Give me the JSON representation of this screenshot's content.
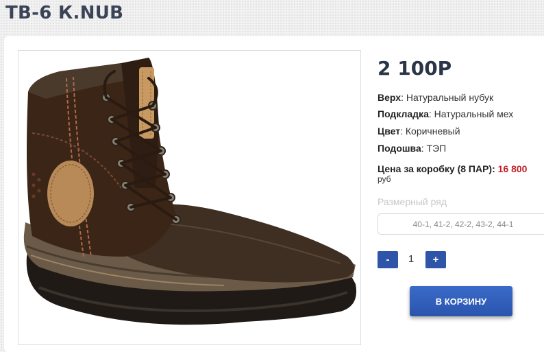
{
  "product": {
    "title": "ТВ-6 К.NUB",
    "price": "2 100Р",
    "image_alt": "brown-leather-nubuck-winter-boot"
  },
  "specs": [
    {
      "key": "Верх",
      "value": ": Натуральный нубук"
    },
    {
      "key": "Подкладка",
      "value": ": Натуральный мех"
    },
    {
      "key": "Цвет",
      "value": ": Коричневый"
    },
    {
      "key": "Подошва",
      "value": ": ТЭП"
    }
  ],
  "box": {
    "label": "Цена за коробку (8 ПАР):",
    "price": "16 800",
    "currency": "руб"
  },
  "sizes": {
    "label": "Размерный ряд",
    "selected": "40-1, 41-2, 42-2, 43-2, 44-1"
  },
  "quantity": {
    "minus": "-",
    "value": "1",
    "plus": "+"
  },
  "cart_button": "В КОРЗИНУ",
  "colors": {
    "accent": "#2f55a8",
    "price_red": "#c0202a",
    "title": "#3a4456"
  }
}
